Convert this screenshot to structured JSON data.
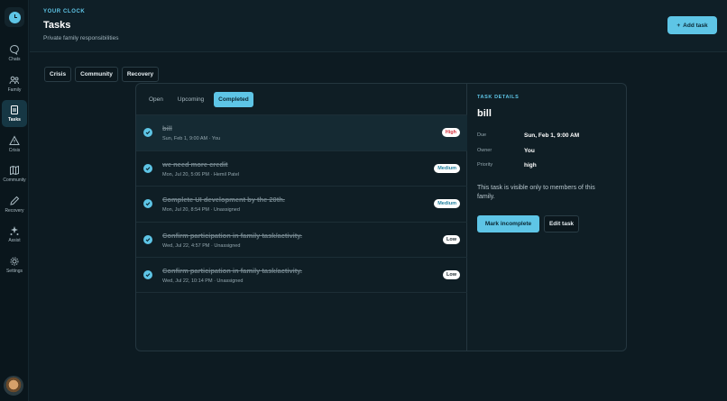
{
  "app": {
    "brand": "YOUR CLOCK",
    "title": "Tasks",
    "subtitle": "Private family responsibilities"
  },
  "header": {
    "add_task_label": "Add task"
  },
  "sidebar": {
    "items": [
      {
        "label": "Chats",
        "icon": "chat-icon"
      },
      {
        "label": "Family",
        "icon": "family-icon"
      },
      {
        "label": "Tasks",
        "icon": "tasks-icon",
        "active": true
      },
      {
        "label": "Crisis",
        "icon": "warning-icon"
      },
      {
        "label": "Community",
        "icon": "map-icon"
      },
      {
        "label": "Recovery",
        "icon": "pencil-icon"
      },
      {
        "label": "Assist",
        "icon": "sparkle-icon"
      },
      {
        "label": "Settings",
        "icon": "gear-icon"
      }
    ]
  },
  "tabs": [
    "Crisis",
    "Community",
    "Recovery"
  ],
  "filters": [
    "Open",
    "Upcoming",
    "Completed"
  ],
  "active_filter": "Completed",
  "tasks": [
    {
      "title": "bill",
      "meta": "Sun, Feb 1, 9:00 AM · You",
      "priority": "High"
    },
    {
      "title": "we need more credit",
      "meta": "Mon, Jul 20, 5:06 PM · Hemil Patel",
      "priority": "Medium"
    },
    {
      "title": "Complete UI development by the 20th.",
      "meta": "Mon, Jul 20, 8:54 PM · Unassigned",
      "priority": "Medium"
    },
    {
      "title": "Confirm participation in family task/activity.",
      "meta": "Wed, Jul 22, 4:57 PM · Unassigned",
      "priority": "Low"
    },
    {
      "title": "Confirm participation in family task/activity.",
      "meta": "Wed, Jul 22, 10:14 PM · Unassigned",
      "priority": "Low"
    }
  ],
  "details": {
    "section_label": "TASK DETAILS",
    "title": "bill",
    "due_label": "Due",
    "due_value": "Sun, Feb 1, 9:00 AM",
    "owner_label": "Owner",
    "owner_value": "You",
    "priority_label": "Priority",
    "priority_value": "high",
    "note": "This task is visible only to members of this family.",
    "mark_incomplete_label": "Mark incomplete",
    "edit_label": "Edit task"
  },
  "colors": {
    "accent": "#5ec5e6",
    "background": "#0d1b22",
    "high": "#d6333f",
    "medium": "#1f7f9e"
  }
}
